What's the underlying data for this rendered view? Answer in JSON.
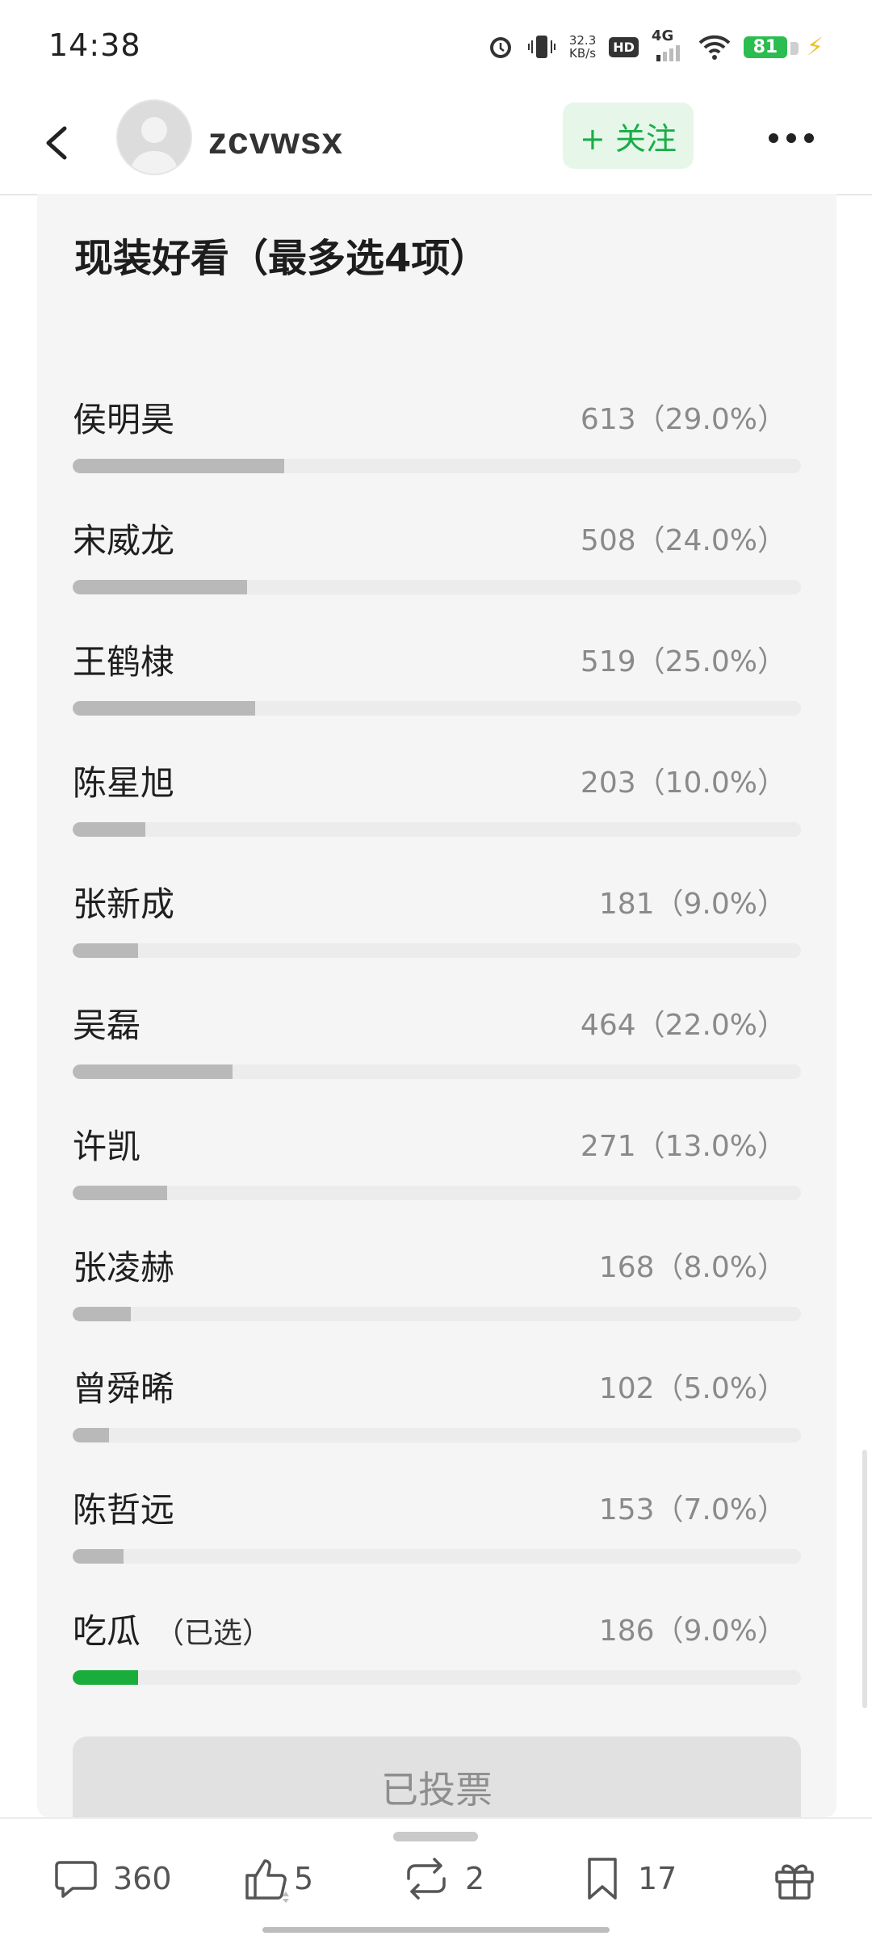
{
  "status_bar": {
    "time": "14:38",
    "net_speed_value": "32.3",
    "net_speed_unit": "KB/s",
    "hd": "HD",
    "network": "4G",
    "battery": "81"
  },
  "header": {
    "username": "zcvwsx",
    "follow_label": "+ 关注"
  },
  "poll": {
    "title": "现装好看（最多选4项）",
    "options": [
      {
        "label": "侯明昊",
        "count": "613（29.0%）",
        "percent": 29.0
      },
      {
        "label": "宋威龙",
        "count": "508（24.0%）",
        "percent": 24.0
      },
      {
        "label": "王鹤棣",
        "count": "519（25.0%）",
        "percent": 25.0
      },
      {
        "label": "陈星旭",
        "count": "203（10.0%）",
        "percent": 10.0
      },
      {
        "label": "张新成",
        "count": "181（9.0%）",
        "percent": 9.0
      },
      {
        "label": "吴磊",
        "count": "464（22.0%）",
        "percent": 22.0
      },
      {
        "label": "许凯",
        "count": "271（13.0%）",
        "percent": 13.0
      },
      {
        "label": "张凌赫",
        "count": "168（8.0%）",
        "percent": 8.0
      },
      {
        "label": "曾舜晞",
        "count": "102（5.0%）",
        "percent": 5.0
      },
      {
        "label": "陈哲远",
        "count": "153（7.0%）",
        "percent": 7.0
      },
      {
        "label": "吃瓜",
        "tag": "（已选）",
        "count": "186（9.0%）",
        "percent": 9.0,
        "selected": true
      }
    ],
    "voted_label": "已投票"
  },
  "actions": {
    "comments": "360",
    "likes": "5",
    "reposts": "2",
    "bookmarks": "17"
  },
  "colors": {
    "accent_green": "#1aad3b",
    "follow_bg": "#e6f7ea",
    "bar_gray": "#b9b9b9"
  }
}
